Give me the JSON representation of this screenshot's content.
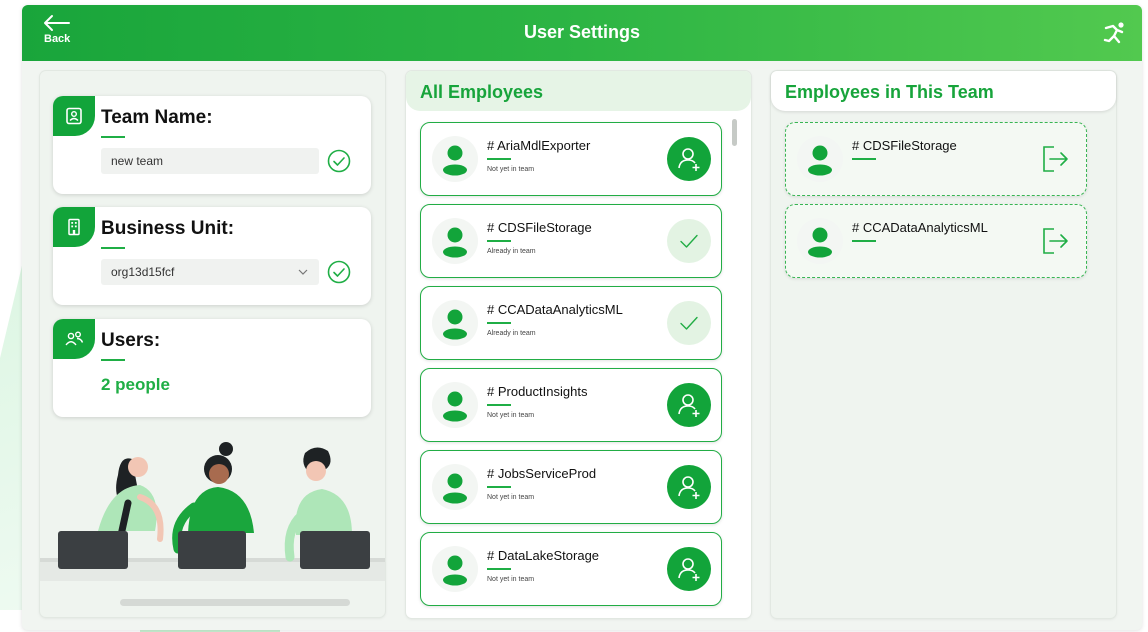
{
  "header": {
    "title": "User Settings",
    "back_label": "Back"
  },
  "team_name": {
    "label": "Team Name:",
    "value": "new team"
  },
  "business_unit": {
    "label": "Business Unit:",
    "value": "org13d15fcf"
  },
  "users": {
    "label": "Users:",
    "count": "2 people"
  },
  "all_employees": {
    "title": "All Employees",
    "items": [
      {
        "name": "# AriaMdlExporter",
        "status": "Not yet in team",
        "in_team": false
      },
      {
        "name": "# CDSFileStorage",
        "status": "Already in team",
        "in_team": true
      },
      {
        "name": "# CCADataAnalyticsML",
        "status": "Already in team",
        "in_team": true
      },
      {
        "name": "# ProductInsights",
        "status": "Not yet in team",
        "in_team": false
      },
      {
        "name": "# JobsServiceProd",
        "status": "Not yet in team",
        "in_team": false
      },
      {
        "name": "# DataLakeStorage",
        "status": "Not yet in team",
        "in_team": false
      }
    ]
  },
  "team_employees": {
    "title": "Employees in This Team",
    "items": [
      {
        "name": "# CDSFileStorage"
      },
      {
        "name": "# CCADataAnalyticsML"
      }
    ]
  },
  "colors": {
    "primary": "#12a43a",
    "header_gradient_start": "#19a53b",
    "header_gradient_end": "#52c94f",
    "accent_text": "#1fae45",
    "panel_bg": "#eff4ef"
  },
  "icons": {
    "back": "arrow-left-icon",
    "header_right": "running-person-icon",
    "team_badge": "id-card-icon",
    "bu_badge": "building-icon",
    "users_badge": "users-icon",
    "add": "add-person-icon",
    "done": "checkmark-icon",
    "leave": "exit-arrow-icon"
  }
}
